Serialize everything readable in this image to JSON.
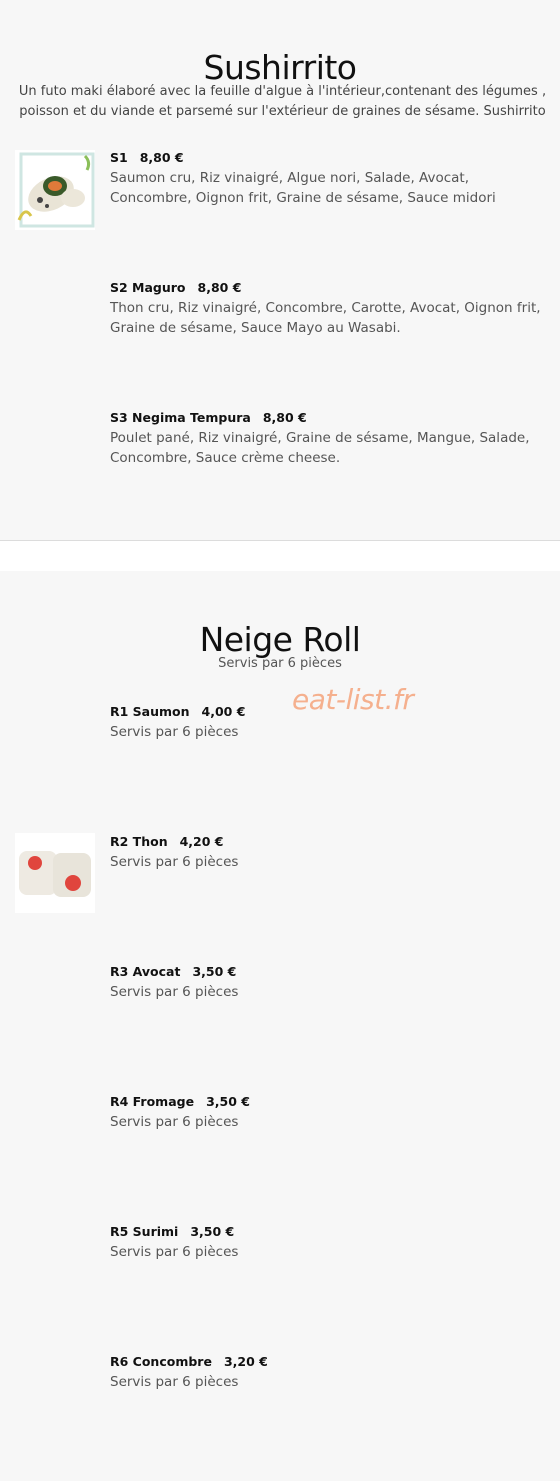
{
  "sushirrito": {
    "title": "Sushirrito",
    "description": "Un futo maki élaboré avec la feuille d'algue à l'intérieur,contenant des légumes , poisson et du viande et parsemé sur l'extérieur de graines de sésame. Sushirrito",
    "items": [
      {
        "code": "S1",
        "price": "8,80 €",
        "description": "Saumon cru, Riz vinaigré, Algue nori, Salade, Avocat, Concombre, Oignon frit, Graine de sésame, Sauce midori",
        "image": "sushirrito-photo"
      },
      {
        "code": "S2 Maguro",
        "price": "8,80 €",
        "description": "Thon cru, Riz vinaigré, Concombre, Carotte, Avocat, Oignon frit, Graine de sésame, Sauce Mayo au Wasabi."
      },
      {
        "code": "S3 Negima Tempura",
        "price": "8,80 €",
        "description": "Poulet pané, Riz vinaigré, Graine de sésame, Mangue, Salade, Concombre, Sauce crème cheese."
      }
    ]
  },
  "neige_roll": {
    "title": "Neige Roll",
    "subtitle": "Servis par 6 pièces",
    "items": [
      {
        "code": "R1 Saumon",
        "price": "4,00 €",
        "description": "Servis par 6 pièces"
      },
      {
        "code": "R2 Thon",
        "price": "4,20 €",
        "description": "Servis par 6 pièces",
        "image": "neige-roll-photo"
      },
      {
        "code": "R3 Avocat",
        "price": "3,50 €",
        "description": "Servis par 6 pièces"
      },
      {
        "code": "R4 Fromage",
        "price": "3,50 €",
        "description": "Servis par 6 pièces"
      },
      {
        "code": "R5 Surimi",
        "price": "3,50 €",
        "description": "Servis par 6 pièces"
      },
      {
        "code": "R6 Concombre",
        "price": "3,20 €",
        "description": "Servis par 6 pièces"
      }
    ]
  },
  "watermark": "eat-list.fr"
}
